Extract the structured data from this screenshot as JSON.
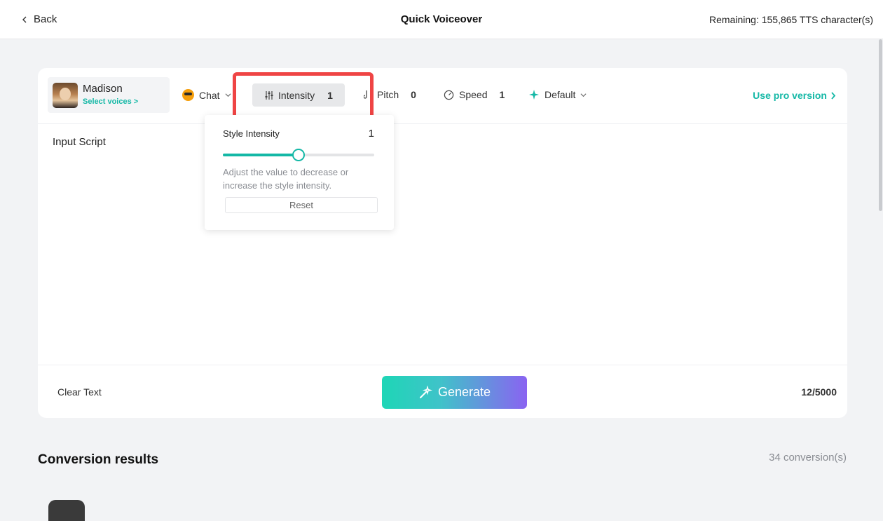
{
  "header": {
    "back_label": "Back",
    "title": "Quick Voiceover",
    "remaining": "Remaining: 155,865 TTS character(s)"
  },
  "voice": {
    "name": "Madison",
    "select_label": "Select voices >"
  },
  "toolbar": {
    "style_label": "Chat",
    "intensity_label": "Intensity",
    "intensity_value": "1",
    "pitch_label": "Pitch",
    "pitch_value": "0",
    "speed_label": "Speed",
    "speed_value": "1",
    "effect_label": "Default",
    "pro_label": "Use pro version"
  },
  "editor": {
    "input_label": "Input Script",
    "script_text": ""
  },
  "footer": {
    "clear_label": "Clear Text",
    "generate_label": "Generate",
    "char_count": "12/5000"
  },
  "intensity_popover": {
    "title": "Style Intensity",
    "value": "1",
    "slider_fraction": 0.5,
    "description": "Adjust the value to decrease or increase the style intensity.",
    "reset_label": "Reset"
  },
  "results": {
    "title": "Conversion results",
    "count": "34 conversion(s)"
  },
  "colors": {
    "accent": "#14b8a6",
    "highlight": "#ef4444",
    "generate_gradient_end": "#8a63f1"
  }
}
